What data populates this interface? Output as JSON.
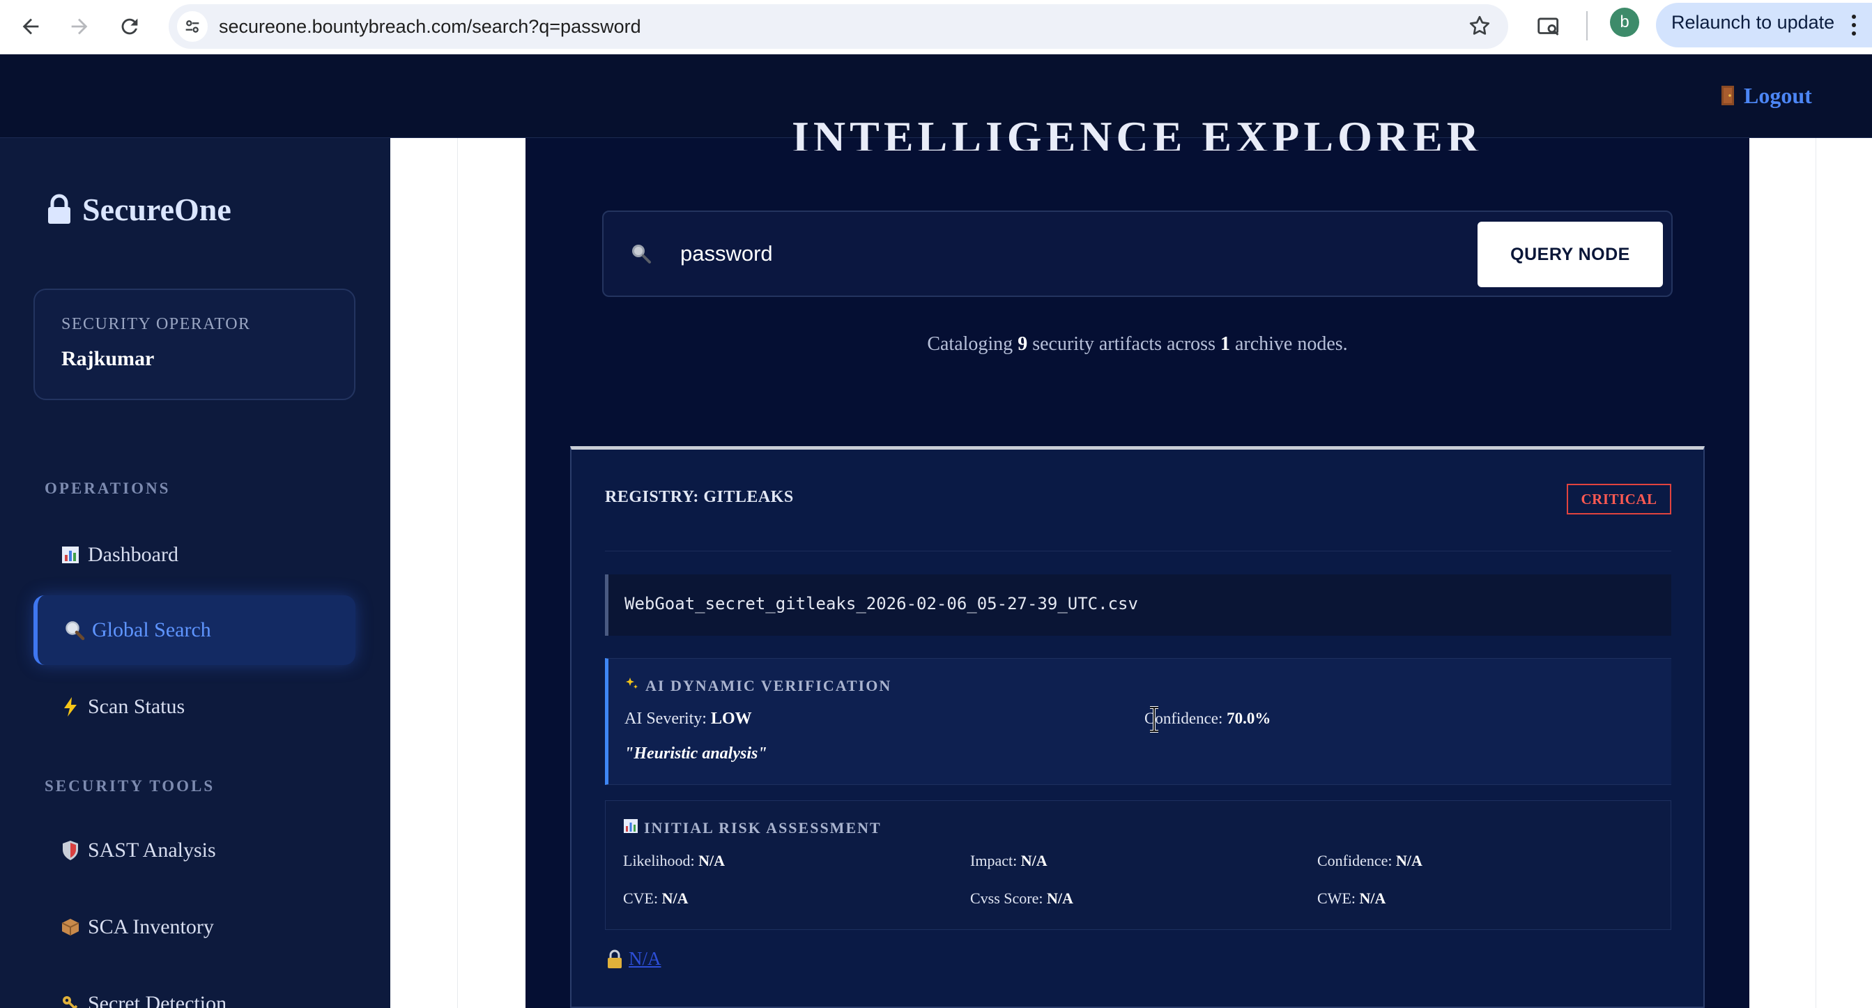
{
  "browser": {
    "url": "secureone.bountybreach.com/search?q=password",
    "profile_initial": "b",
    "relaunch_label": "Relaunch to update"
  },
  "header": {
    "logout_label": "Logout"
  },
  "sidebar": {
    "brand": "SecureOne",
    "operator_role": "SECURITY OPERATOR",
    "operator_name": "Rajkumar",
    "sections": [
      {
        "title": "OPERATIONS"
      },
      {
        "title": "SECURITY TOOLS"
      }
    ],
    "items": [
      {
        "label": "Dashboard",
        "icon": "chart-icon"
      },
      {
        "label": "Global Search",
        "icon": "search-icon",
        "active": true
      },
      {
        "label": "Scan Status",
        "icon": "lightning-icon"
      },
      {
        "label": "SAST Analysis",
        "icon": "shield-icon"
      },
      {
        "label": "SCA Inventory",
        "icon": "package-icon"
      },
      {
        "label": "Secret Detection",
        "icon": "key-icon"
      }
    ]
  },
  "main": {
    "page_title": "INTELLIGENCE EXPLORER",
    "search": {
      "value": "password",
      "button_label": "QUERY NODE"
    },
    "catalog": {
      "prefix": "Cataloging",
      "artifact_count": "9",
      "middle": "security artifacts across",
      "node_count": "1",
      "suffix": "archive nodes."
    },
    "result": {
      "registry": "REGISTRY: GITLEAKS",
      "severity": "CRITICAL",
      "file_name": "WebGoat_secret_gitleaks_2026-02-06_05-27-39_UTC.csv",
      "ai": {
        "heading": "AI DYNAMIC VERIFICATION",
        "severity_label": "AI Severity:",
        "severity_value": "LOW",
        "confidence_label": "Confidence:",
        "confidence_value": "70.0%",
        "note": "\"Heuristic analysis\""
      },
      "risk": {
        "heading": "INITIAL RISK ASSESSMENT",
        "likelihood_label": "Likelihood:",
        "likelihood_value": "N/A",
        "impact_label": "Impact:",
        "impact_value": "N/A",
        "confidence_label": "Confidence:",
        "confidence_value": "N/A",
        "cve_label": "CVE:",
        "cve_value": "N/A",
        "cvss_label": "Cvss Score:",
        "cvss_value": "N/A",
        "cwe_label": "CWE:",
        "cwe_value": "N/A"
      },
      "link_label": "N/A"
    }
  },
  "colors": {
    "accent": "#4c86f5",
    "critical": "#e0433e",
    "panel": "#050f33",
    "sidebar": "#0d1a3d"
  }
}
